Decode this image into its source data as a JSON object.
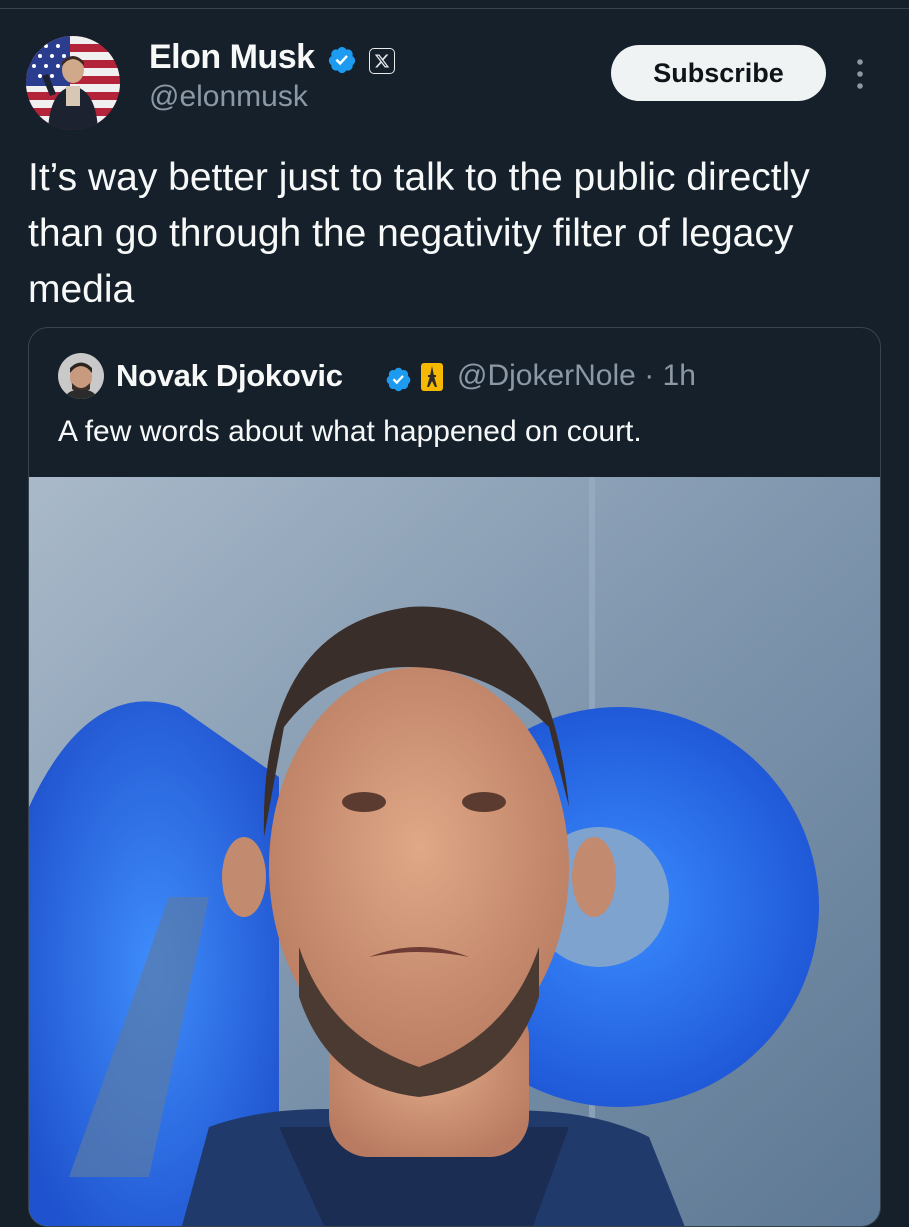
{
  "post": {
    "author_name": "Elon Musk",
    "author_handle": "@elonmusk",
    "subscribe_label": "Subscribe",
    "text": "It’s way better just to talk to the public directly than go through the negativity filter of legacy media"
  },
  "quoted_post": {
    "author_name": "Novak Djokovic",
    "author_handle": "@DjokerNole",
    "time": "1h",
    "separator": "·",
    "text": "A few words about what happened on court."
  },
  "colors": {
    "background": "#15202b",
    "verified": "#1d9bf0",
    "secondary_text": "#8b98a5",
    "border": "#38444d",
    "button_bg": "#eff3f4"
  },
  "icons": [
    "verified-badge-icon",
    "x-logo-icon",
    "more-options-icon",
    "eiffel-tower-emoji-icon"
  ]
}
